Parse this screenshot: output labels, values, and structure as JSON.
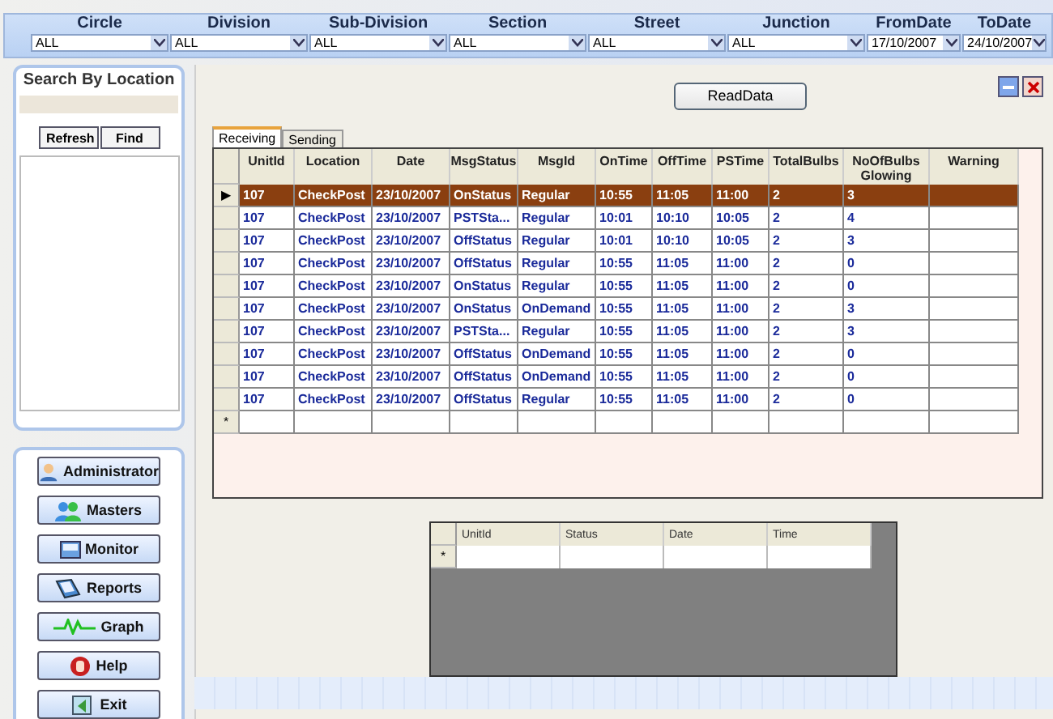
{
  "filters": [
    {
      "label": "Circle",
      "value": "ALL",
      "kind": "wide"
    },
    {
      "label": "Division",
      "value": "ALL",
      "kind": "wide"
    },
    {
      "label": "Sub-Division",
      "value": "ALL",
      "kind": "wide"
    },
    {
      "label": "Section",
      "value": "ALL",
      "kind": "wide"
    },
    {
      "label": "Street",
      "value": "ALL",
      "kind": "wide"
    },
    {
      "label": "Junction",
      "value": "ALL",
      "kind": "wide"
    },
    {
      "label": "FromDate",
      "value": "17/10/2007",
      "kind": "date"
    },
    {
      "label": "ToDate",
      "value": "24/10/2007",
      "kind": "date"
    }
  ],
  "search": {
    "title": "Search By Location",
    "buttons": [
      "Refresh",
      "Find"
    ]
  },
  "nav": [
    {
      "label": "Administrator",
      "kind": "admin"
    },
    {
      "label": "Masters",
      "kind": "masters"
    },
    {
      "label": "Monitor",
      "kind": "monitor"
    },
    {
      "label": "Reports",
      "kind": "reports"
    },
    {
      "label": "Graph",
      "kind": "graph"
    },
    {
      "label": "Help",
      "kind": "help"
    },
    {
      "label": "Exit",
      "kind": "exit"
    }
  ],
  "read_button": "ReadData",
  "tabs": [
    {
      "label": "Receiving",
      "selected": true
    },
    {
      "label": "Sending",
      "selected": false
    }
  ],
  "table": {
    "columns": [
      "UnitId",
      "Location",
      "Date",
      "MsgStatus",
      "MsgId",
      "OnTime",
      "OffTime",
      "PSTime",
      "TotalBulbs",
      "NoOfBulbs Glowing",
      "Warning"
    ],
    "rows": [
      {
        "indicator": "▶",
        "selected": true,
        "cells": [
          "107",
          "CheckPost",
          "23/10/2007",
          "OnStatus",
          "Regular",
          "10:55",
          "11:05",
          "11:00",
          "2",
          "3",
          ""
        ]
      },
      {
        "selected": false,
        "cells": [
          "107",
          "CheckPost",
          "23/10/2007",
          "PSTSta...",
          "Regular",
          "10:01",
          "10:10",
          "10:05",
          "2",
          "4",
          ""
        ]
      },
      {
        "selected": false,
        "cells": [
          "107",
          "CheckPost",
          "23/10/2007",
          "OffStatus",
          "Regular",
          "10:01",
          "10:10",
          "10:05",
          "2",
          "3",
          ""
        ]
      },
      {
        "selected": false,
        "cells": [
          "107",
          "CheckPost",
          "23/10/2007",
          "OffStatus",
          "Regular",
          "10:55",
          "11:05",
          "11:00",
          "2",
          "0",
          ""
        ]
      },
      {
        "selected": false,
        "cells": [
          "107",
          "CheckPost",
          "23/10/2007",
          "OnStatus",
          "Regular",
          "10:55",
          "11:05",
          "11:00",
          "2",
          "0",
          ""
        ]
      },
      {
        "selected": false,
        "cells": [
          "107",
          "CheckPost",
          "23/10/2007",
          "OnStatus",
          "OnDemand",
          "10:55",
          "11:05",
          "11:00",
          "2",
          "3",
          ""
        ]
      },
      {
        "selected": false,
        "cells": [
          "107",
          "CheckPost",
          "23/10/2007",
          "PSTSta...",
          "Regular",
          "10:55",
          "11:05",
          "11:00",
          "2",
          "3",
          ""
        ]
      },
      {
        "selected": false,
        "cells": [
          "107",
          "CheckPost",
          "23/10/2007",
          "OffStatus",
          "OnDemand",
          "10:55",
          "11:05",
          "11:00",
          "2",
          "0",
          ""
        ]
      },
      {
        "selected": false,
        "cells": [
          "107",
          "CheckPost",
          "23/10/2007",
          "OffStatus",
          "OnDemand",
          "10:55",
          "11:05",
          "11:00",
          "2",
          "0",
          ""
        ]
      },
      {
        "selected": false,
        "cells": [
          "107",
          "CheckPost",
          "23/10/2007",
          "OffStatus",
          "Regular",
          "10:55",
          "11:05",
          "11:00",
          "2",
          "0",
          ""
        ]
      }
    ],
    "new_row_marker": "*"
  },
  "small_table": {
    "columns": [
      "UnitId",
      "Status",
      "Date",
      "Time"
    ],
    "new_row_marker": "*"
  }
}
